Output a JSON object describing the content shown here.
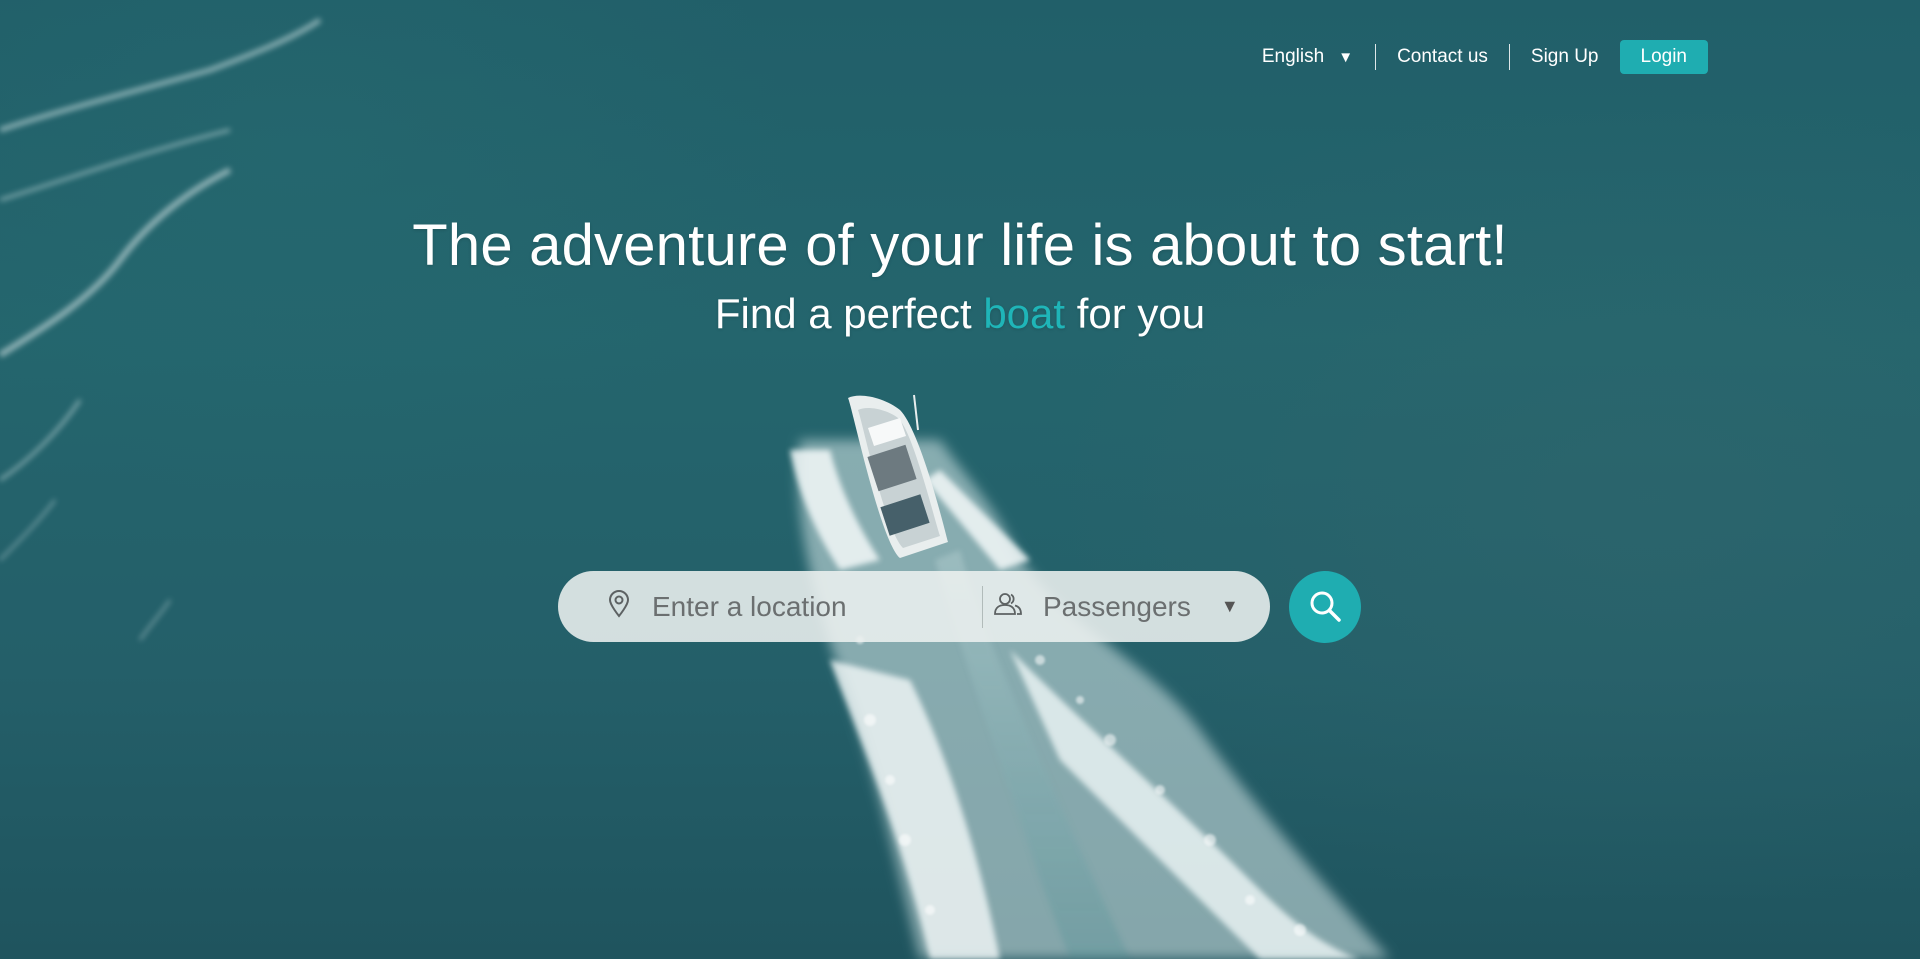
{
  "nav": {
    "language": {
      "selected": "English",
      "caret_icon": "caret-down-icon"
    },
    "contact_label": "Contact us",
    "signup_label": "Sign Up",
    "login_label": "Login"
  },
  "hero": {
    "headline": "The adventure of your life is about to start!",
    "subline_before": "Find a perfect ",
    "subline_accent": "boat",
    "subline_after": " for you",
    "background_image": "aerial-ocean-speedboat"
  },
  "search": {
    "location_placeholder": "Enter a location",
    "location_value": "",
    "location_icon": "map-pin-icon",
    "passengers_label": "Passengers",
    "passengers_icon": "users-icon",
    "passengers_caret": "caret-down-icon",
    "search_icon": "search-icon"
  },
  "colors": {
    "accent": "#1fadb1",
    "ocean": "#215f69",
    "text": "#ffffff"
  }
}
